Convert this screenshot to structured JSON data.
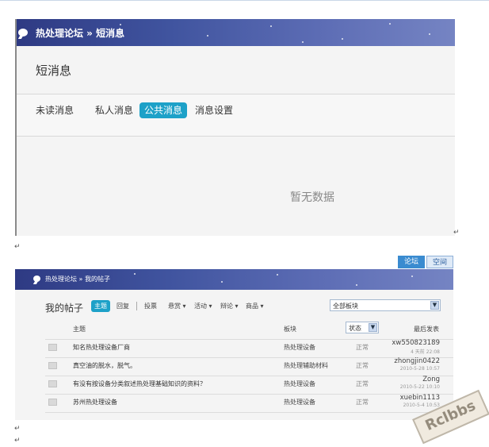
{
  "section1": {
    "breadcrumb": "热处理论坛 » 短消息",
    "page_title": "短消息",
    "tabs": [
      {
        "label": "未读消息",
        "active": false
      },
      {
        "label": "私人消息",
        "active": false
      },
      {
        "label": "公共消息",
        "active": true
      },
      {
        "label": "消息设置",
        "active": false
      }
    ],
    "empty_text": "暂无数据"
  },
  "return_mark": "↵",
  "section2": {
    "top_tabs": [
      {
        "label": "论坛",
        "active": true
      },
      {
        "label": "空间",
        "active": false
      }
    ],
    "breadcrumb": "热处理论坛 » 我的帖子",
    "heading": "我的帖子",
    "filters": [
      {
        "label": "主题",
        "active": true
      },
      {
        "label": "回复",
        "active": false
      },
      {
        "label": "投票",
        "active": false
      },
      {
        "label": "悬赏 ▾",
        "active": false
      },
      {
        "label": "活动 ▾",
        "active": false
      },
      {
        "label": "辩论 ▾",
        "active": false
      },
      {
        "label": "商品 ▾",
        "active": false
      }
    ],
    "board_select": {
      "value": "全部板块"
    },
    "columns": {
      "subject": "主题",
      "board": "板块",
      "state": "状态",
      "last_post": "最后发表"
    },
    "rows": [
      {
        "title": "知名热处理设备厂商",
        "board": "热处理设备",
        "state": "正常",
        "user": "xw550823189",
        "time": "4 天前 22:08"
      },
      {
        "title": "真空油的脱水，脱气。",
        "board": "热处理辅助材料",
        "state": "正常",
        "user": "zhongjin0422",
        "time": "2010-5-28 10:57"
      },
      {
        "title": "有没有按设备分类叙述热处理基础知识的资料？",
        "board": "热处理设备",
        "state": "正常",
        "user": "Zong",
        "time": "2010-5-22 10:10"
      },
      {
        "title": "苏州热处理设备",
        "board": "热处理设备",
        "state": "正常",
        "user": "xuebin1113",
        "time": "2010-5-4 10:53"
      }
    ]
  },
  "stamp": {
    "text": "Rclbbs"
  },
  "colors": {
    "accent": "#1da1c8",
    "band_dark": "#2e3a83",
    "band_light": "#7584c3"
  }
}
